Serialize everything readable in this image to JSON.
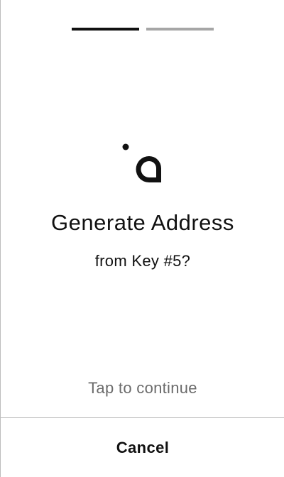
{
  "progress": {
    "total_steps": 2,
    "current_step": 1,
    "active_color": "#111111",
    "inactive_color": "#a6a6a6"
  },
  "logo": {
    "icon": "app-logo-icon"
  },
  "dialog": {
    "title": "Generate Address",
    "subtitle": "from Key #5?",
    "hint": "Tap to continue"
  },
  "actions": {
    "cancel_label": "Cancel"
  }
}
